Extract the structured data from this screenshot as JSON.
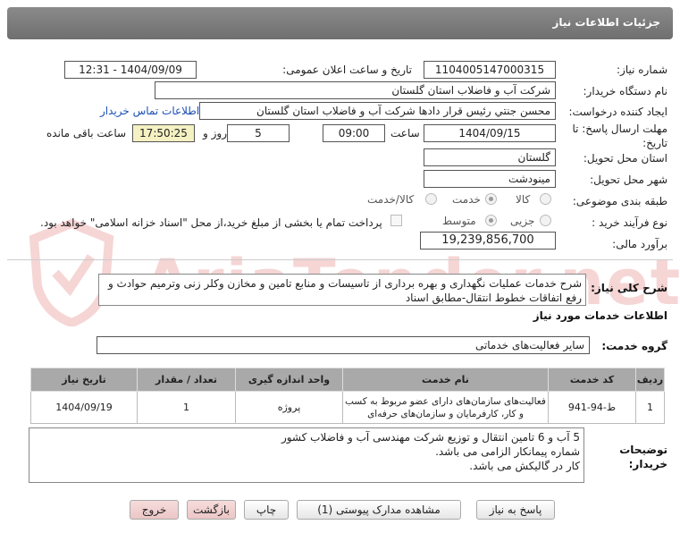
{
  "header": {
    "title": "جزئیات اطلاعات نیاز"
  },
  "fields": {
    "need_number_label": "شماره نیاز:",
    "need_number": "1104005147000315",
    "announce_label": "تاریخ و ساعت اعلان عمومی:",
    "announce_value": "1404/09/09 - 12:31",
    "buyer_org_label": "نام دستگاه خریدار:",
    "buyer_org": "شرکت آب و فاضلاب استان گلستان",
    "creator_label": "ایجاد کننده درخواست:",
    "creator": "محسن جنتي رئیس قرار دادها شرکت آب و فاضلاب استان گلستان",
    "buyer_contact_link": "اطلاعات تماس خریدار",
    "deadline_label": "مهلت ارسال پاسخ: تا تاریخ:",
    "deadline_date": "1404/09/15",
    "time_label": "ساعت",
    "deadline_time": "09:00",
    "days_value": "5",
    "days_label": "روز و",
    "remaining_time": "17:50:25",
    "remaining_label": "ساعت باقی مانده",
    "province_label": "استان محل تحویل:",
    "province": "گلستان",
    "city_label": "شهر محل تحویل:",
    "city": "مینودشت",
    "category_label": "طبقه بندی موضوعی:",
    "category_options": [
      "کالا",
      "خدمت",
      "کالا/خدمت"
    ],
    "category_selected": "خدمت",
    "process_label": "نوع فرآیند خرید :",
    "process_options": [
      "جزیی",
      "متوسط"
    ],
    "process_selected": "متوسط",
    "payment_note": "پرداخت تمام یا بخشی از مبلغ خرید،از محل \"اسناد خزانه اسلامی\" خواهد بود.",
    "estimate_label": "برآورد مالی:",
    "estimate": "19,239,856,700"
  },
  "description": {
    "label": "شرح کلی نیاز:",
    "text": "شرح خدمات عملیات نگهداری و بهره برداری از تاسیسات و منابع تامین و مخازن وکلر زنی وترمیم حوادث و رفع اتفاقات خطوط انتقال-مطابق اسناد"
  },
  "services": {
    "section_title": "اطلاعات خدمات مورد نیاز",
    "group_label": "گروه خدمت:",
    "group_value": "سایر فعالیت‌های خدماتی",
    "columns": [
      "ردیف",
      "کد خدمت",
      "نام خدمت",
      "واحد اندازه گیری",
      "تعداد / مقدار",
      "تاریخ نیاز"
    ],
    "rows": [
      {
        "index": "1",
        "code": "ط-94-941",
        "name": "فعالیت‌های سازمان‌های دارای عضو مربوط به کسب و کار، کارفرمایان و سازمان‌های حرفه‌ای",
        "unit": "پروژه",
        "qty": "1",
        "date": "1404/09/19"
      }
    ]
  },
  "buyer_notes": {
    "label": "توضیحات خریدار:",
    "lines": [
      "5 آب و 6 تامین انتقال و توزیع شرکت مهندسی آب و فاضلاب کشور",
      "شماره پیمانکار الزامی می باشد.",
      "کار در گالیکش می باشد."
    ]
  },
  "buttons": {
    "reply": "پاسخ به نیاز",
    "attachments": "مشاهده مدارک پیوستی (1)",
    "print": "چاپ",
    "back": "بازگشت",
    "exit": "خروج"
  },
  "watermark": {
    "text": "AriaTender.net"
  },
  "colors": {
    "titlebar": "#7a7a7a",
    "link": "#1a4fb5",
    "remaining_bg": "#f5f1c2",
    "table_header": "#a9a9a9"
  }
}
